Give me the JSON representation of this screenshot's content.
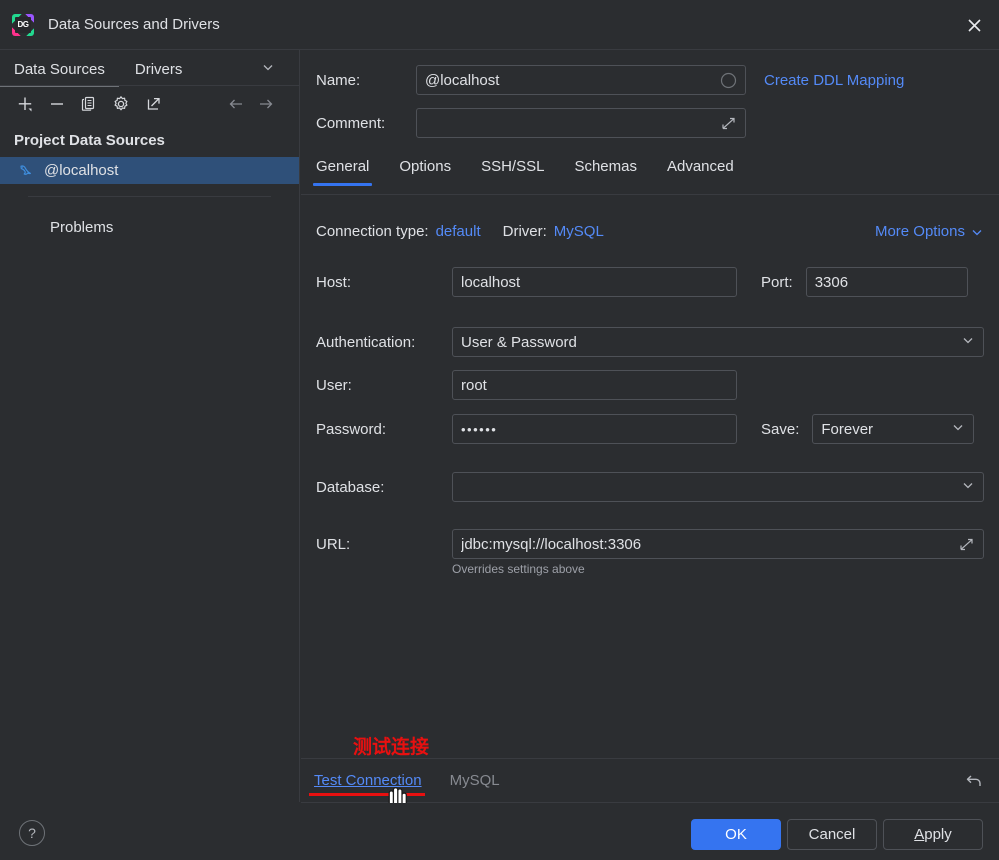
{
  "window": {
    "title": "Data Sources and Drivers",
    "logo_text": "DG",
    "close_icon": "close-icon"
  },
  "sidebar": {
    "tabs": [
      {
        "label": "Data Sources",
        "active": true
      },
      {
        "label": "Drivers",
        "active": false
      }
    ],
    "tabs_chevron_icon": "chevron-down-icon",
    "toolbar": [
      {
        "name": "add-data-source-button",
        "icon": "plus-icon"
      },
      {
        "name": "remove-data-source-button",
        "icon": "minus-icon"
      },
      {
        "name": "duplicate-data-source-button",
        "icon": "copy-icon"
      },
      {
        "name": "data-source-properties-button",
        "icon": "gear-icon"
      },
      {
        "name": "import-data-source-button",
        "icon": "external-link-icon"
      },
      {
        "name": "navigate-back-button",
        "icon": "arrow-left-icon"
      },
      {
        "name": "navigate-forward-button",
        "icon": "arrow-right-icon"
      }
    ],
    "group_title": "Project Data Sources",
    "items": [
      {
        "label": "@localhost",
        "icon": "mysql-dolphin-icon",
        "selected": true
      }
    ],
    "problems_label": "Problems"
  },
  "form": {
    "name_label": "Name:",
    "name_value": "@localhost",
    "name_icon": "circle-icon",
    "comment_label": "Comment:",
    "comment_value": "",
    "comment_expand_icon": "expand-icon",
    "create_ddl_mapping_label": "Create DDL Mapping"
  },
  "tabs": [
    {
      "label": "General",
      "active": true
    },
    {
      "label": "Options",
      "active": false
    },
    {
      "label": "SSH/SSL",
      "active": false
    },
    {
      "label": "Schemas",
      "active": false
    },
    {
      "label": "Advanced",
      "active": false
    }
  ],
  "general": {
    "connection_type_label": "Connection type:",
    "connection_type_value": "default",
    "driver_label": "Driver:",
    "driver_value": "MySQL",
    "more_options_label": "More Options",
    "more_options_icon": "chevron-down-icon",
    "host_label": "Host:",
    "host_value": "localhost",
    "port_label": "Port:",
    "port_value": "3306",
    "authentication_label": "Authentication:",
    "authentication_value": "User & Password",
    "user_label": "User:",
    "user_value": "root",
    "password_label": "Password:",
    "password_value": "••••••",
    "save_label": "Save:",
    "save_value": "Forever",
    "database_label": "Database:",
    "database_value": "",
    "url_label": "URL:",
    "url_value": "jdbc:mysql://localhost:3306",
    "url_expand_icon": "expand-icon",
    "url_hint": "Overrides settings above"
  },
  "status_bar": {
    "test_connection_label": "Test Connection",
    "driver_name": "MySQL",
    "revert_icon": "undo-icon"
  },
  "annotation": {
    "text": "测试连接",
    "color": "#e81010"
  },
  "footer": {
    "help_label": "?",
    "ok_label": "OK",
    "cancel_label": "Cancel",
    "apply_label": "Apply",
    "apply_mnemonic": "A",
    "apply_rest": "pply"
  },
  "cursor": {
    "icon": "pointing-hand-cursor"
  },
  "colors": {
    "background": "#2b2d30",
    "selection": "#2f5079",
    "accent": "#3574f0",
    "link": "#548af7",
    "annotation_red": "#e81010",
    "border": "#4e5157"
  }
}
